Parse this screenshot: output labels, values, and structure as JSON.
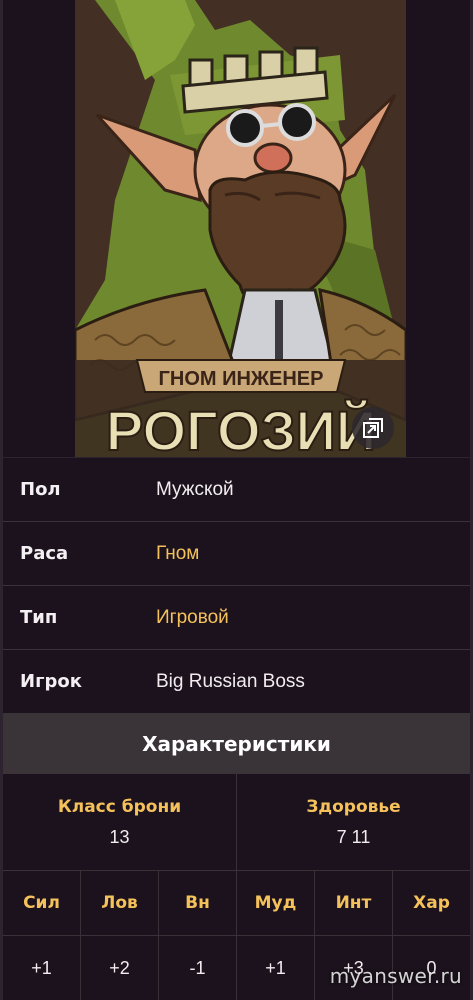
{
  "portrait": {
    "caption_top": "ГНОМ ИНЖЕНЕР",
    "caption_name": "РОГОЗИЙ"
  },
  "info": [
    {
      "key": "Пол",
      "value": "Мужской",
      "link": false
    },
    {
      "key": "Раса",
      "value": "Гном",
      "link": true
    },
    {
      "key": "Тип",
      "value": "Игровой",
      "link": true
    },
    {
      "key": "Игрок",
      "value": "Big Russian Boss",
      "link": false
    }
  ],
  "characteristics": {
    "title": "Характеристики",
    "armor_class": {
      "label": "Класс брони",
      "value": "13"
    },
    "health": {
      "label": "Здоровье",
      "value": "7 11"
    },
    "abilities": [
      {
        "label": "Сил",
        "value": "+1"
      },
      {
        "label": "Лов",
        "value": "+2"
      },
      {
        "label": "Вн",
        "value": "-1"
      },
      {
        "label": "Муд",
        "value": "+1"
      },
      {
        "label": "Инт",
        "value": "+3"
      },
      {
        "label": "Хар",
        "value": "0"
      }
    ]
  },
  "watermark": "myanswer.ru",
  "colors": {
    "background": "#1c121d",
    "accent": "#f4c15a",
    "header_band": "#3a3338",
    "divider": "#3a3038"
  },
  "icons": {
    "expand": "expand-image-icon"
  }
}
